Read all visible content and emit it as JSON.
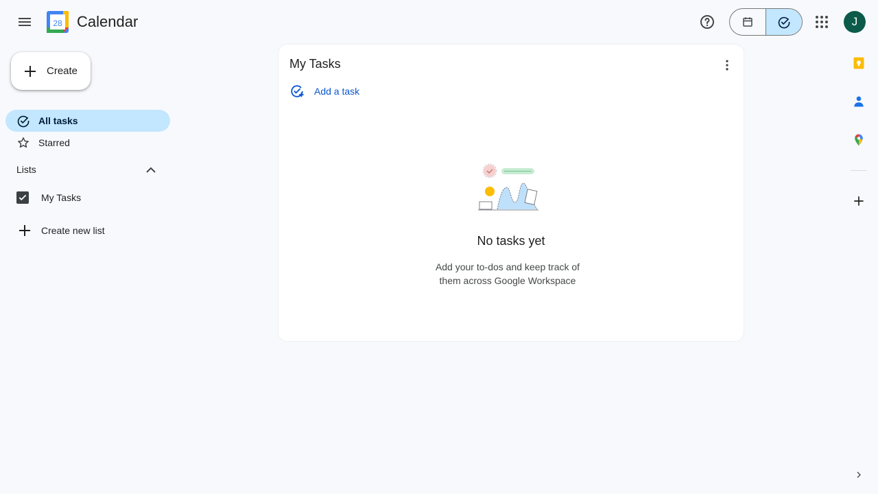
{
  "header": {
    "app_title": "Calendar",
    "logo_day": "28",
    "avatar_initial": "J"
  },
  "create_button": {
    "label": "Create"
  },
  "sidebar": {
    "items": [
      {
        "label": "All tasks",
        "icon": "check-circle-icon",
        "selected": true
      },
      {
        "label": "Starred",
        "icon": "star-icon",
        "selected": false
      }
    ],
    "lists_heading": "Lists",
    "lists": [
      {
        "label": "My Tasks",
        "checked": true
      }
    ],
    "create_list_label": "Create new list"
  },
  "main": {
    "title": "My Tasks",
    "add_task_label": "Add a task",
    "empty_title": "No tasks yet",
    "empty_description": "Add your to-dos and keep track of them across Google Workspace"
  },
  "colors": {
    "accent_blue": "#0b57d0",
    "selected_bg": "#c2e7ff",
    "avatar_bg": "#0b5a4a",
    "page_bg": "#f8f9fd"
  }
}
